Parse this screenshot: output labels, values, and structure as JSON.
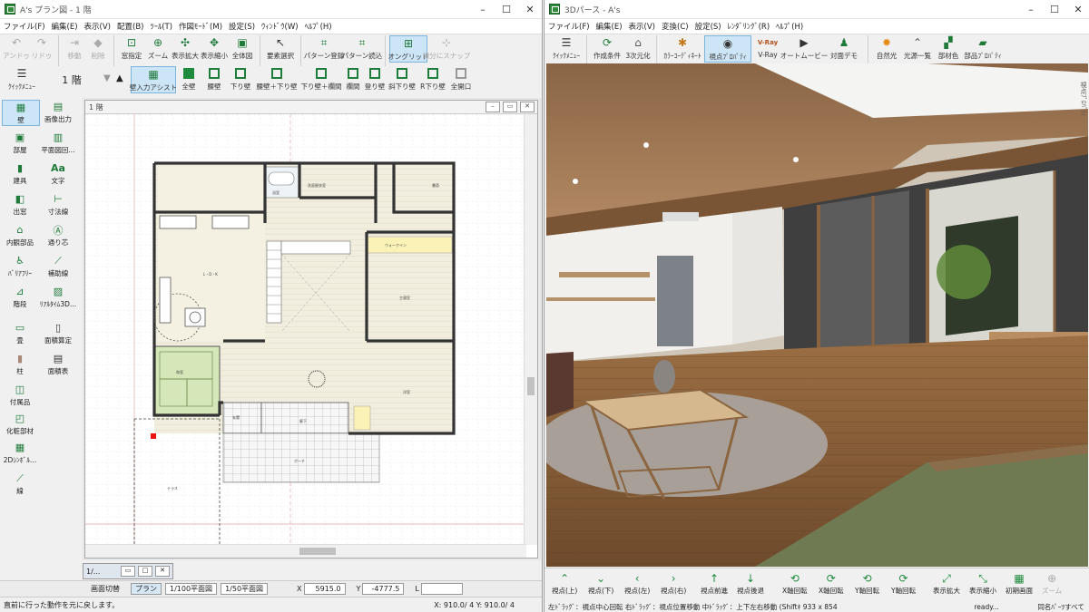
{
  "plan": {
    "title": "A's プラン図 - 1 階",
    "menu": [
      "ファイル(F)",
      "編集(E)",
      "表示(V)",
      "配置(B)",
      "ﾂｰﾙ(T)",
      "作図ﾓｰﾄﾞ(M)",
      "設定(S)",
      "ｳｨﾝﾄﾞｳ(W)",
      "ﾍﾙﾌﾟ(H)"
    ],
    "toolbar1": [
      "アンドゥ",
      "リドゥ",
      "移動",
      "削除",
      "窓指定",
      "ズーム",
      "表示拡大",
      "表示縮小",
      "全体図",
      "要素選択",
      "パターン登録",
      "パターン読込",
      "オングリッド",
      "線分にスナップ"
    ],
    "quick_menu": "ｸｲｯｸﾒﾆｭｰ",
    "floor": "1 階",
    "toolbar2": [
      "壁入力アシスト",
      "全壁",
      "腰壁",
      "下り壁",
      "腰壁＋下り壁",
      "下り壁＋欄間",
      "欄間",
      "登り壁",
      "斜下り壁",
      "R下り壁",
      "全開口"
    ],
    "left_tools": [
      {
        "label": "壁",
        "icon": "wall-icon"
      },
      {
        "label": "画像出力",
        "icon": "image-export-icon"
      },
      {
        "label": "部屋",
        "icon": "room-icon"
      },
      {
        "label": "平面図回...",
        "icon": "plan-drawing-icon"
      },
      {
        "label": "建具",
        "icon": "door-icon"
      },
      {
        "label": "文字",
        "icon": "text-icon"
      },
      {
        "label": "出窓",
        "icon": "bay-window-icon"
      },
      {
        "label": "寸法線",
        "icon": "dimension-icon"
      },
      {
        "label": "内観部品",
        "icon": "interior-parts-icon"
      },
      {
        "label": "通り芯",
        "icon": "grid-line-icon"
      },
      {
        "label": "ﾊﾞﾘｱﾌﾘｰ",
        "icon": "barrier-free-icon"
      },
      {
        "label": "補助線",
        "icon": "guide-line-icon"
      },
      {
        "label": "階段",
        "icon": "stairs-icon"
      },
      {
        "label": "ﾘｱﾙﾀｲﾑ3D...",
        "icon": "realtime-3d-icon"
      },
      {
        "label": "畳",
        "icon": "tatami-icon"
      },
      {
        "label": "面積算定",
        "icon": "area-calc-icon"
      },
      {
        "label": "柱",
        "icon": "pillar-icon"
      },
      {
        "label": "面積表",
        "icon": "area-table-icon"
      },
      {
        "label": "付属品",
        "icon": "accessory-icon"
      },
      {
        "label": "化粧部材",
        "icon": "trim-icon"
      },
      {
        "label": "2Dｼﾝﾎﾞﾙ...",
        "icon": "2d-symbol-icon"
      },
      {
        "label": "線",
        "icon": "line-icon"
      }
    ],
    "child_title": "1 階",
    "rooms": [
      "L・D・K",
      "和室",
      "主寝室",
      "浴室",
      "洗面脱衣室",
      "書斎",
      "玄関",
      "洋室",
      "ウォークイン",
      "ポーチ",
      "テラス",
      "廊下"
    ],
    "mini_title": "1/...",
    "status": {
      "switch": "画面切替",
      "plan_btn": "プラン",
      "scale1": "1/100平面図",
      "scale2": "1/50平面図",
      "x_label": "X",
      "x_value": "5915.0",
      "y_label": "Y",
      "y_value": "-4777.5",
      "l_label": "L"
    },
    "status_line": "直前に行った動作を元に戻します。",
    "coords": "X: 910.0/ 4     Y: 910.0/ 4"
  },
  "perspective": {
    "title": "3Dパース - A's",
    "menu": [
      "ファイル(F)",
      "編集(E)",
      "表示(V)",
      "変換(C)",
      "設定(S)",
      "ﾚﾝﾀﾞﾘﾝｸﾞ(R)",
      "ﾍﾙﾌﾟ(H)"
    ],
    "toolbar": [
      "ｸｲｯｸﾒﾆｭｰ",
      "作成条件",
      "3次元化",
      "ｶﾗｰｺｰﾃﾞｨﾈｰﾄ",
      "視点ﾌﾟﾛﾊﾟﾃｨ",
      "V-Ray",
      "オートムービー",
      "対面デモ",
      "自然光",
      "光源一覧",
      "部材色",
      "部品ﾌﾟﾛﾊﾟﾃｨ"
    ],
    "vray_badge": "V-Ray",
    "side_label": "視点ﾌﾟﾛﾊﾟﾃｨ",
    "nav": [
      "視点(上)",
      "視点(下)",
      "視点(左)",
      "視点(右)",
      "視点前進",
      "視点後退",
      "X軸回転",
      "X軸回転",
      "Y軸回転",
      "Y軸回転",
      "表示拡大",
      "表示縮小",
      "初期画面",
      "ズーム"
    ],
    "status_line": "左ﾄﾞﾗｯｸﾞ：視点中心回転  右ﾄﾞﾗｯｸﾞ：視点位置移動  中ﾄﾞﾗｯｸﾞ：上下左右移動   (Shiftｷ 933 x 854",
    "ready": "ready...",
    "right_status": "同名ﾊﾟｰﾂすべて"
  }
}
